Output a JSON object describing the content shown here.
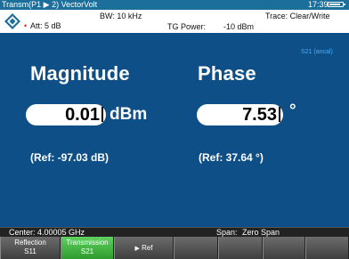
{
  "title_bar": {
    "title": "Transm(P1 ▶ 2) VectorVolt",
    "time": "17:39"
  },
  "info_bar": {
    "att_marker": "•",
    "att": "Att:  5 dB",
    "bw": "BW:    10 kHz",
    "tg_power_label": "TG Power:",
    "tg_power_value": "-10 dBm",
    "trace": "Trace:  Clear/Write"
  },
  "display": {
    "trace_id": "S21 (ancal)",
    "magnitude": {
      "label": "Magnitude",
      "value": "0.01",
      "unit": "dBm",
      "ref": "(Ref: -97.03 dB)"
    },
    "phase": {
      "label": "Phase",
      "value": "7.53",
      "unit": "°",
      "ref": "(Ref: 37.64 °)"
    }
  },
  "status_bar": {
    "center": "Center: 4.00005 GHz",
    "span_label": "Span:",
    "span_value": "Zero Span"
  },
  "softkeys": [
    {
      "line1": "Reflection",
      "line2": "S11",
      "active": false
    },
    {
      "line1": "Transmission",
      "line2": "S21",
      "active": true
    },
    {
      "label": "Ref",
      "icon": "triangle-right-icon",
      "active": false
    },
    {
      "label": "",
      "active": false
    },
    {
      "label": "",
      "active": false
    },
    {
      "label": "",
      "active": false
    },
    {
      "label": "",
      "active": false
    }
  ],
  "colors": {
    "title_bar": "#1c6f9a",
    "display_bg": "#0d4f86",
    "trace_id": "#46b0ff",
    "softkey_active": "#3aae3a"
  }
}
